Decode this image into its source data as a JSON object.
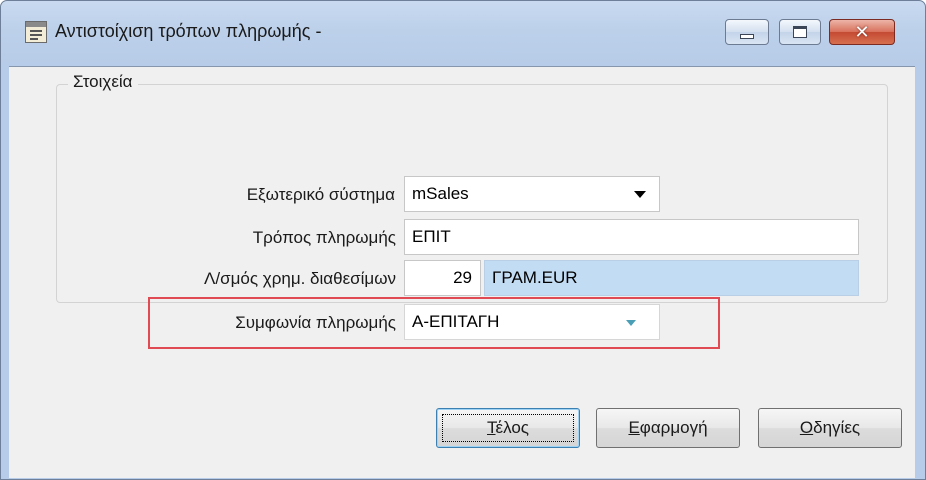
{
  "window": {
    "title": "Αντιστοίχιση τρόπων πληρωμής -",
    "controls": {
      "minimize_icon": "minimize-icon",
      "maximize_icon": "maximize-icon",
      "close_glyph": "✕"
    }
  },
  "group": {
    "legend": "Στοιχεία",
    "fields": {
      "external_system": {
        "label": "Εξωτερικό σύστημα",
        "value": "mSales"
      },
      "payment_method": {
        "label": "Τρόπος πληρωμής",
        "value": "ΕΠΙΤ"
      },
      "cash_account": {
        "label": "Λ/σμός χρημ. διαθεσίμων",
        "code": "29",
        "name": "ΓΡΑΜ.EUR"
      },
      "payment_agreement": {
        "label": "Συμφωνία πληρωμής",
        "value": "Α-ΕΠΙΤΑΓΗ"
      }
    }
  },
  "buttons": {
    "finish": {
      "accel": "Τ",
      "rest": "έλος"
    },
    "apply": {
      "accel": "Ε",
      "rest": "φαρμογή"
    },
    "help": {
      "accel": "Ο",
      "rest": "δηγίες"
    }
  },
  "colors": {
    "highlight": "#e04a52",
    "selection": "#c2dcf3",
    "title_bg": "#bcd0ea"
  }
}
